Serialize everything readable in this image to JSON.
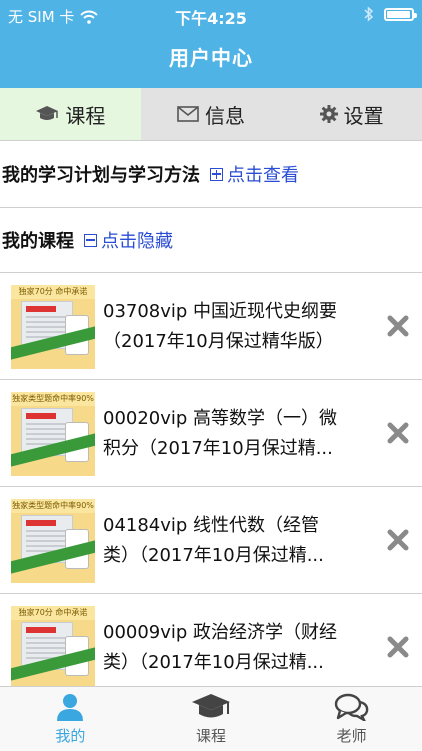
{
  "status_bar": {
    "carrier": "无 SIM 卡",
    "time": "下午4:25",
    "battery_level": 0.95
  },
  "nav": {
    "title": "用户中心"
  },
  "tabs": [
    {
      "label": "课程",
      "icon": "graduation-cap-icon",
      "active": true
    },
    {
      "label": "信息",
      "icon": "envelope-icon",
      "active": false
    },
    {
      "label": "设置",
      "icon": "gear-icon",
      "active": false
    }
  ],
  "plan": {
    "label": "我的学习计划与学习方法",
    "link": "点击查看",
    "link_icon": "plus-box-icon"
  },
  "my_courses": {
    "label": "我的课程",
    "link": "点击隐藏",
    "link_icon": "minus-box-icon"
  },
  "courses": [
    {
      "line1": "03708vip 中国近现代史纲要",
      "line2": "（2017年10月保过精华版）",
      "thumb_banner": "独家70分 命中承诺"
    },
    {
      "line1": "00020vip 高等数学（一）微",
      "line2": "积分（2017年10月保过精...",
      "thumb_banner": "独家类型题命中率90%"
    },
    {
      "line1": "04184vip 线性代数（经管",
      "line2": "类）（2017年10月保过精...",
      "thumb_banner": "独家类型题命中率90%"
    },
    {
      "line1": "00009vip 政治经济学（财经",
      "line2": "类）（2017年10月保过精...",
      "thumb_banner": "独家70分 命中承诺"
    }
  ],
  "tabbar": [
    {
      "label": "我的",
      "icon": "user-icon",
      "active": true
    },
    {
      "label": "课程",
      "icon": "graduation-cap-icon",
      "active": false
    },
    {
      "label": "老师",
      "icon": "chat-bubbles-icon",
      "active": false
    }
  ],
  "colors": {
    "nav_bg": "#4fb3e6",
    "link": "#2a4dd4",
    "active_tab_bg": "#e6f7df",
    "tabbar_active": "#3aa7e0"
  }
}
